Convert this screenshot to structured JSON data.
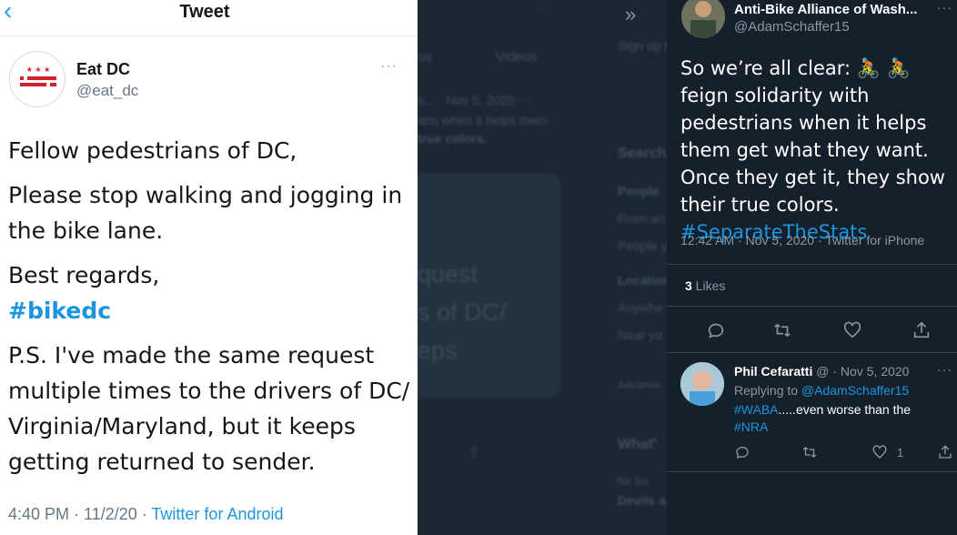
{
  "left_tweet": {
    "header_title": "Tweet",
    "author_name": "Eat DC",
    "author_handle": "@eat_dc",
    "more_label": "···",
    "body": {
      "line1": "Fellow pedestrians of DC,",
      "line2": "Please stop walking and jogging in the bike lane.",
      "line3": "Best regards,",
      "hashtag": "#bikedc",
      "line4": "P.S. I've made the same request multiple times to the drivers of DC/ Virginia/Maryland, but it keeps getting returned to sender."
    },
    "timestamp": "4:40 PM · 11/2/20 · ",
    "source": "Twitter for Android",
    "logo_stars": "★ ★ ★"
  },
  "background_panel": {
    "tab_photos": "os",
    "tab_videos": "Videos",
    "dots": "···",
    "tweet_date": "s... · Nov 5, 2020 ···",
    "tweet_line": "ans when it helps them",
    "tweet_line_bold": "true colors.",
    "big_text_lines": [
      "quest",
      "s of DC/",
      "eps"
    ],
    "side_labels": {
      "sign": "Sign up to",
      "search": "Search",
      "people": "People",
      "from": "From an",
      "people_you": "People yo",
      "location": "Location",
      "anywhere": "Anywhe",
      "near": "Near yo",
      "advanced": "Advance",
      "whats": "What'",
      "news": "Ne    Sa",
      "devils": "Devils a"
    }
  },
  "right_tweet": {
    "author_name": "Anti-Bike Alliance of Wash...",
    "author_handle": "@AdamSchaffer15",
    "more_label": "···",
    "body_text": "So we’re all clear: 🚴 🚴 feign solidarity with pedestrians when it helps them get what they want. Once they get it, they show their true colors.",
    "hashtag": "#SeparateTheStats",
    "meta": "12:42 AM · Nov 5, 2020 · Twitter for iPhone",
    "likes_count": "3",
    "likes_label": " Likes",
    "reply": {
      "name": "Phil Cefaratti",
      "meta": " @ · Nov 5, 2020",
      "more_label": "···",
      "replying_prefix": "Replying to ",
      "replying_to": "@AdamSchaffer15",
      "hashtag1": "#WABA",
      "text": ".....even worse than the",
      "hashtag2": "#NRA",
      "like_count": "1"
    }
  },
  "colors": {
    "accent": "#1b95e0",
    "dark_bg": "#15202b",
    "light_bg": "#ffffff",
    "logo_red": "#d4202c"
  },
  "icons": [
    "back-chevron-icon",
    "more-icon",
    "reply-icon",
    "retweet-icon",
    "like-icon",
    "share-icon",
    "double-chevron-icon"
  ]
}
